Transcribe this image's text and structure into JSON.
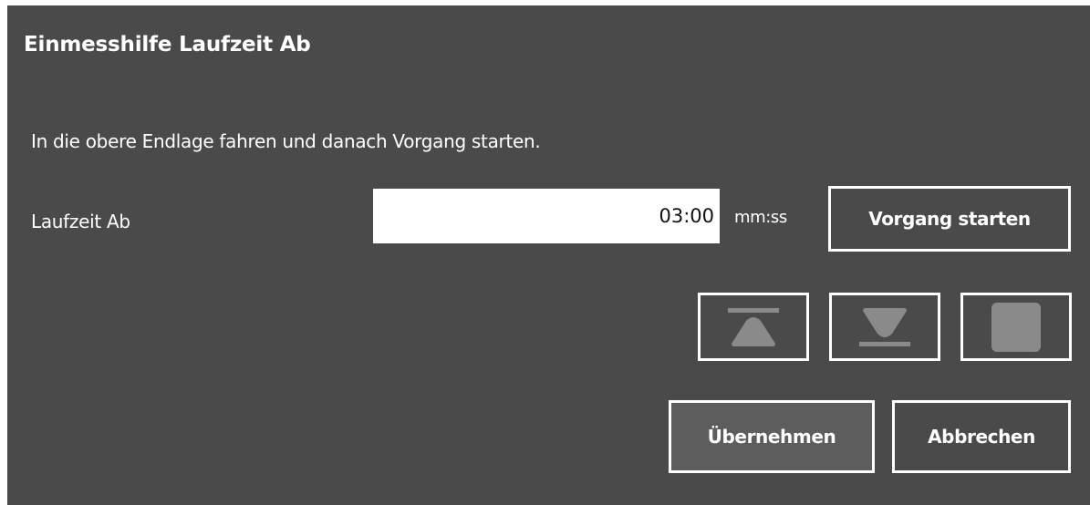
{
  "dialog": {
    "title": "Einmesshilfe Laufzeit Ab",
    "instruction": "In die obere Endlage fahren und danach Vorgang starten.",
    "field": {
      "label": "Laufzeit Ab",
      "value": "03:00",
      "unit": "mm:ss"
    },
    "buttons": {
      "start_label": "Vorgang starten",
      "move_up_icon": "move-up-to-end-icon",
      "move_down_icon": "move-down-to-end-icon",
      "stop_icon": "stop-icon",
      "apply_label": "Übernehmen",
      "cancel_label": "Abbrechen"
    }
  },
  "colors": {
    "dialog_background": "#4a4a4a",
    "disabled_icon": "#8a8a8a",
    "text": "#ffffff",
    "input_background": "#ffffff",
    "apply_button_background": "#5d5d5d"
  }
}
